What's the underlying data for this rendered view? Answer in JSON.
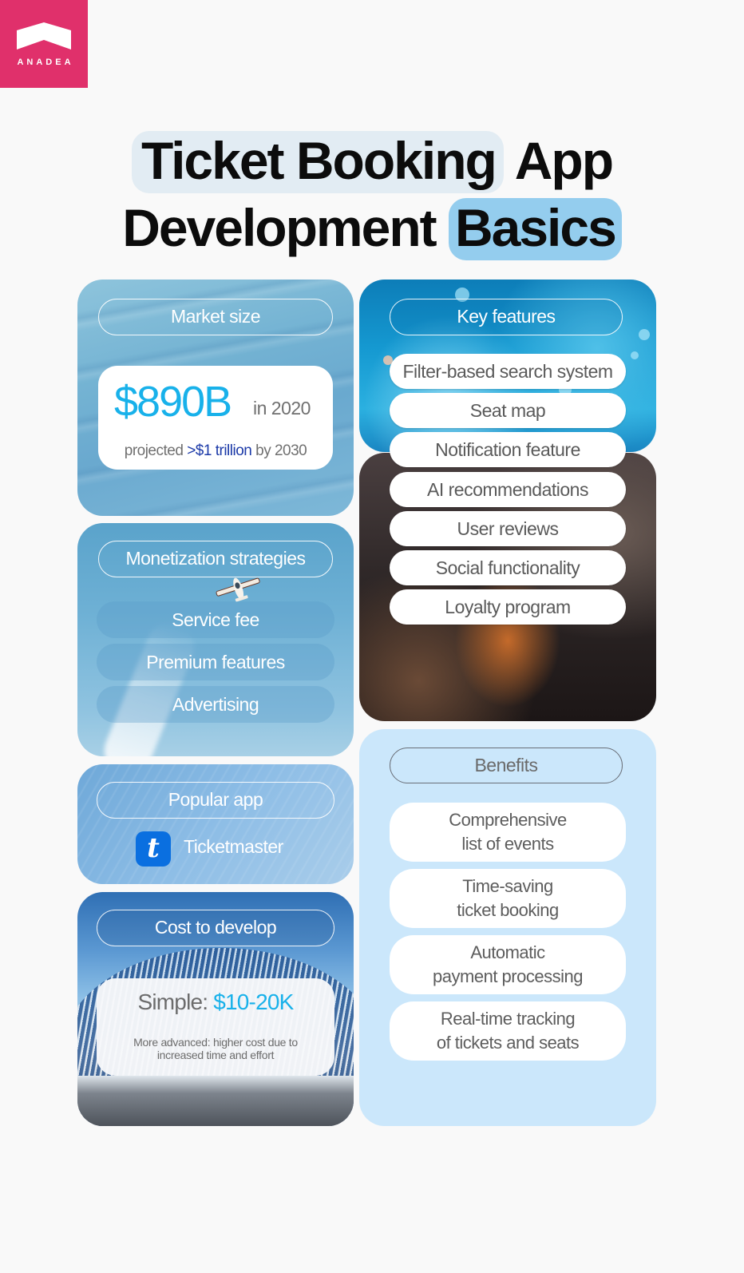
{
  "brand": {
    "name": "ANADEA",
    "logo_icon": "house-roof-icon",
    "color": "#e0306b"
  },
  "title": {
    "line1_highlight": "Ticket Booking",
    "line1_rest": "App",
    "line2_rest": "Development",
    "line2_highlight": "Basics"
  },
  "colors": {
    "accent_cyan": "#18b1ea",
    "accent_navy": "#1c3aa8",
    "benefits_bg": "#cbe7fb",
    "background": "#f9f9f9"
  },
  "market_size": {
    "heading": "Market size",
    "value": "$890B",
    "year_label": "in 2020",
    "projection_prefix": "projected",
    "projection_value": ">$1 trillion",
    "projection_suffix": "by 2030"
  },
  "monetization": {
    "heading": "Monetization strategies",
    "icon": "airplane-icon",
    "items": [
      "Service fee",
      "Premium features",
      "Advertising"
    ]
  },
  "popular_app": {
    "heading": "Popular app",
    "app_icon_letter": "t",
    "app_name": "Ticketmaster"
  },
  "cost": {
    "heading": "Cost to develop",
    "simple_label": "Simple:",
    "simple_value": "$10-20K",
    "advanced_note": "More advanced: higher cost due to increased time and effort"
  },
  "key_features": {
    "heading": "Key features",
    "items": [
      "Filter-based search system",
      "Seat map",
      "Notification feature",
      "AI recommendations",
      "User reviews",
      "Social functionality",
      "Loyalty program"
    ]
  },
  "benefits": {
    "heading": "Benefits",
    "items": [
      {
        "line1": "Comprehensive",
        "line2": "list of events"
      },
      {
        "line1": "Time-saving",
        "line2": "ticket booking"
      },
      {
        "line1": "Automatic",
        "line2": "payment processing"
      },
      {
        "line1": "Real-time tracking",
        "line2": "of tickets and seats"
      }
    ]
  }
}
